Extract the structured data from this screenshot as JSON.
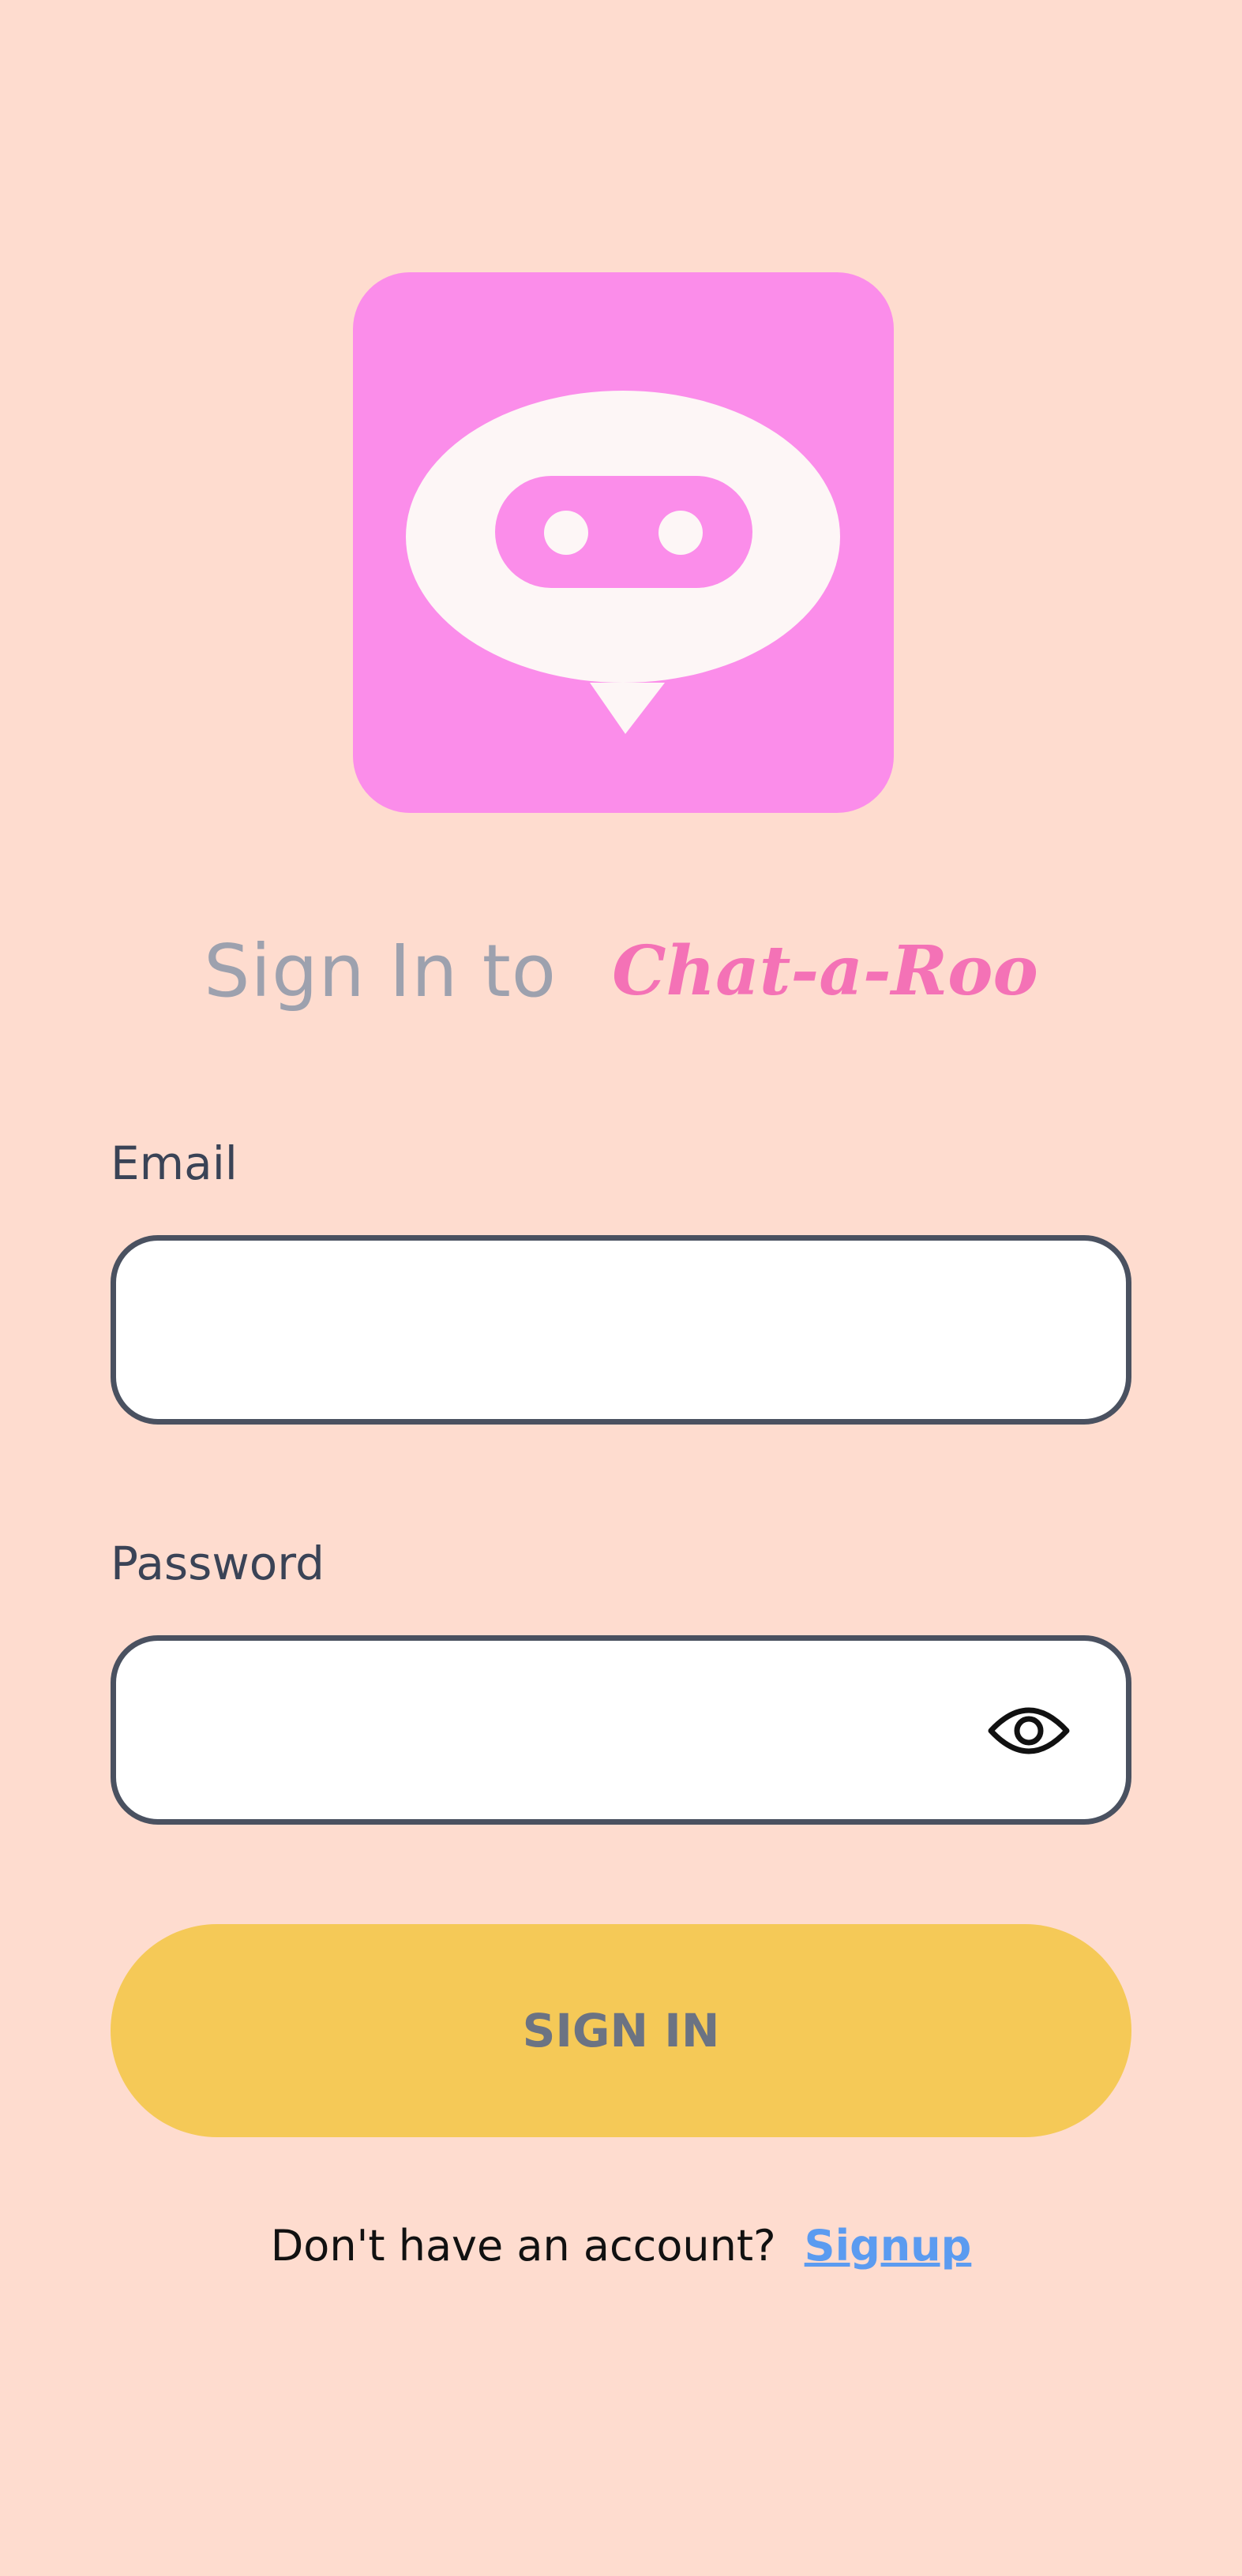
{
  "colors": {
    "background": "#FEDCCF",
    "logo_bg": "#FB8DEA",
    "brand": "#F472B6",
    "button": "#F5C957",
    "link": "#5B9BF0"
  },
  "logo": {
    "icon": "chat-bubble-robot-face-icon"
  },
  "title": {
    "prefix": "Sign In to",
    "brand": "Chat-a-Roo"
  },
  "form": {
    "email_label": "Email",
    "email_value": "",
    "password_label": "Password",
    "password_value": "",
    "password_toggle_icon": "eye-icon",
    "signin_label": "SIGN IN"
  },
  "footer": {
    "prompt": "Don't have an account?",
    "signup_link": "Signup"
  }
}
